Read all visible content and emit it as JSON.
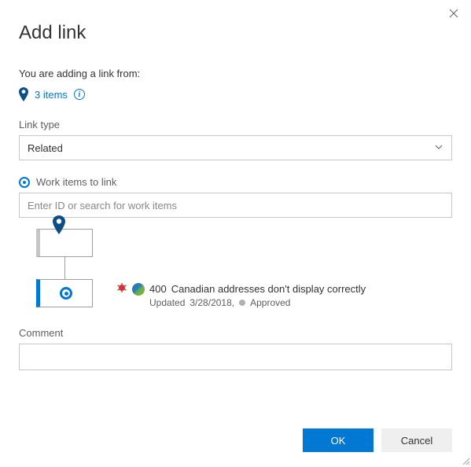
{
  "dialog": {
    "title": "Add link",
    "intro": "You are adding a link from:",
    "items_count_text": "3 items"
  },
  "link_type": {
    "label": "Link type",
    "value": "Related"
  },
  "work_items": {
    "label": "Work items to link",
    "search_placeholder": "Enter ID or search for work items"
  },
  "linked_item": {
    "type_icon": "bug-icon",
    "id": "400",
    "title": "Canadian addresses don't display correctly",
    "updated_label": "Updated",
    "updated_date": "3/28/2018,",
    "state": "Approved"
  },
  "comment": {
    "label": "Comment",
    "value": ""
  },
  "buttons": {
    "ok": "OK",
    "cancel": "Cancel"
  }
}
